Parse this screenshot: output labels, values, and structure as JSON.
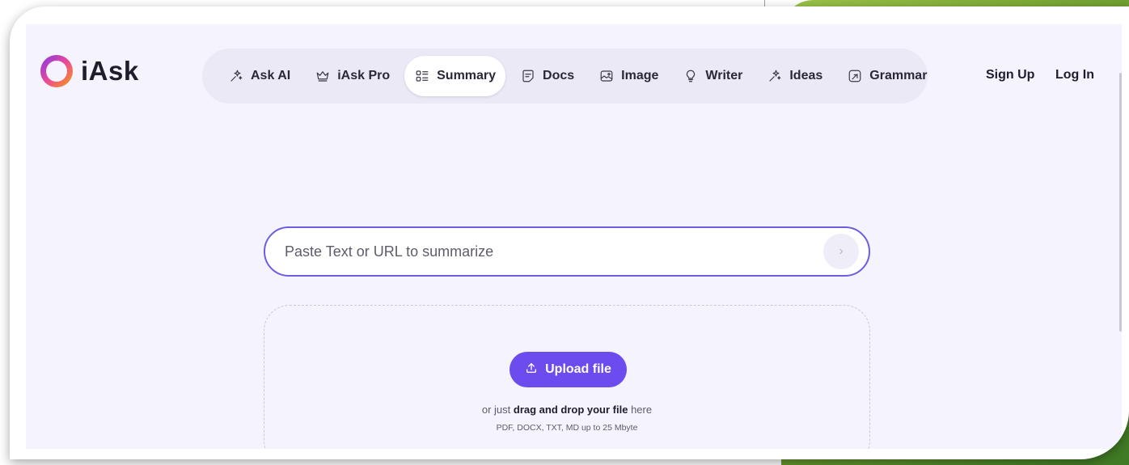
{
  "brand": {
    "name": "iAsk"
  },
  "nav": {
    "items": [
      {
        "label": "Ask AI",
        "icon": "sparkles-icon",
        "active": false
      },
      {
        "label": "iAsk Pro",
        "icon": "crown-icon",
        "active": false
      },
      {
        "label": "Summary",
        "icon": "list-icon",
        "active": true
      },
      {
        "label": "Docs",
        "icon": "document-icon",
        "active": false
      },
      {
        "label": "Image",
        "icon": "image-icon",
        "active": false
      },
      {
        "label": "Writer",
        "icon": "lightbulb-icon",
        "active": false
      },
      {
        "label": "Ideas",
        "icon": "sparkles-icon",
        "active": false
      },
      {
        "label": "Grammar",
        "icon": "feather-icon",
        "active": false
      }
    ]
  },
  "auth": {
    "signup": "Sign Up",
    "login": "Log In"
  },
  "search": {
    "placeholder": "Paste Text or URL to summarize",
    "value": "",
    "submit_glyph": "›"
  },
  "upload": {
    "button_label": "Upload file",
    "hint_prefix": "or just ",
    "hint_bold": "drag and drop your file",
    "hint_suffix": " here",
    "formats": "PDF, DOCX, TXT, MD up to 25 Mbyte"
  },
  "colors": {
    "accent": "#6c4bef",
    "search_border": "#6b5ee0",
    "page_bg": "#f4f3fe"
  }
}
